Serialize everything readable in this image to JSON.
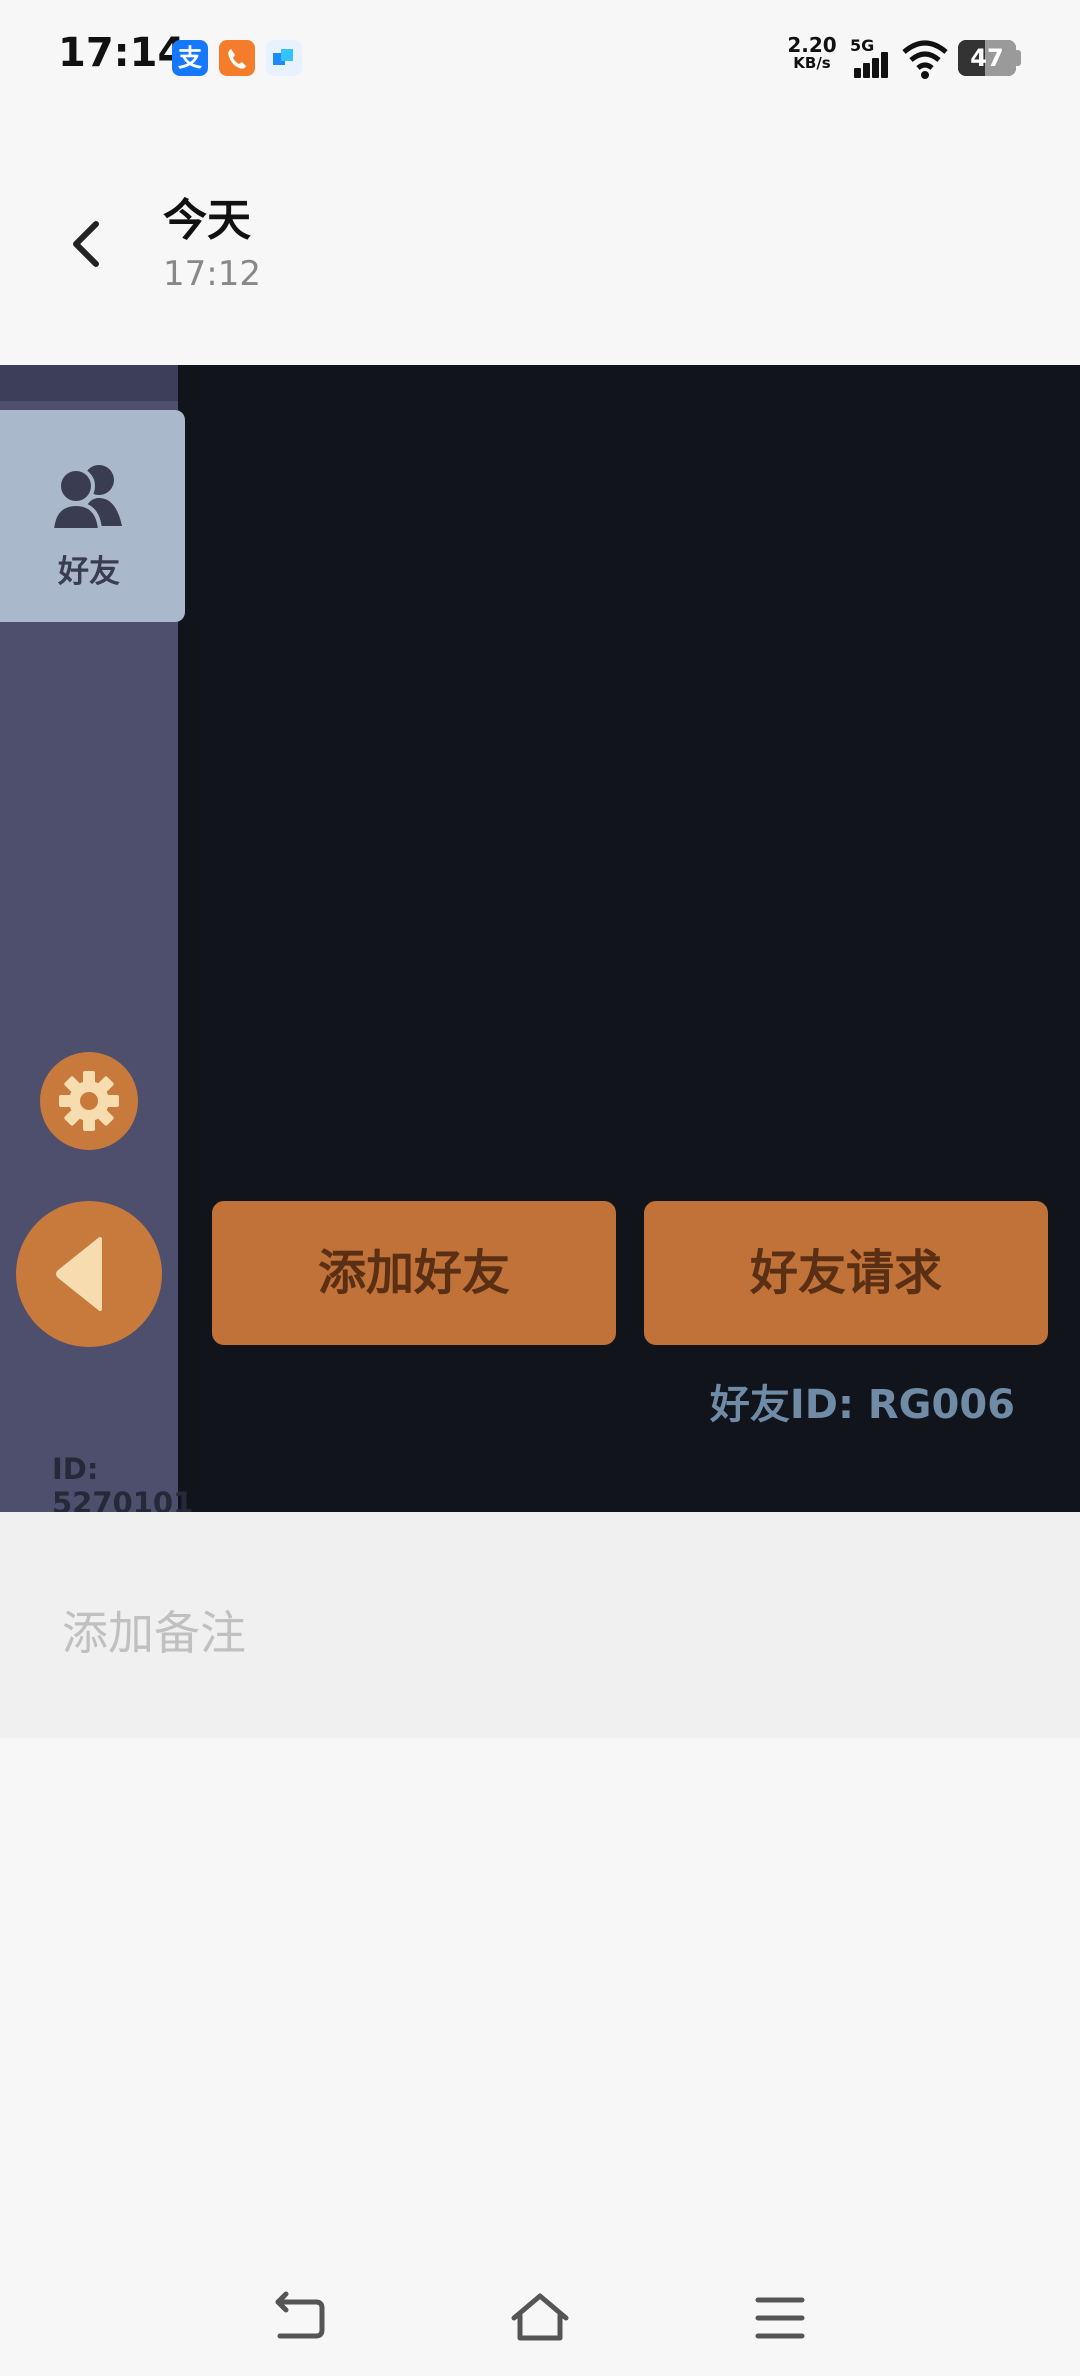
{
  "status_bar": {
    "time": "17:14",
    "apps": [
      "支"
    ],
    "net_speed_value": "2.20",
    "net_speed_unit": "KB/s",
    "network": "5G",
    "battery_level": "47"
  },
  "header": {
    "title": "今天",
    "subtitle": "17:12"
  },
  "game": {
    "sidebar": {
      "friends_tab_label": "好友",
      "user_id": "ID: 5270101"
    },
    "buttons": {
      "add_friend": "添加好友",
      "friend_requests": "好友请求"
    },
    "friend_id": "好友ID: RG006"
  },
  "note": {
    "placeholder": "添加备注"
  },
  "colors": {
    "game_background": "#12141c",
    "sidebar": "#4e4f6c",
    "accent_orange": "#c07238",
    "tab_active": "#aab8cc"
  },
  "icons": {
    "back": "chevron-left-icon",
    "friends": "friends-icon",
    "settings": "gear-icon",
    "collapse": "triangle-left-icon",
    "nav_back": "nav-back-icon",
    "nav_home": "home-icon",
    "nav_menu": "menu-icon"
  }
}
